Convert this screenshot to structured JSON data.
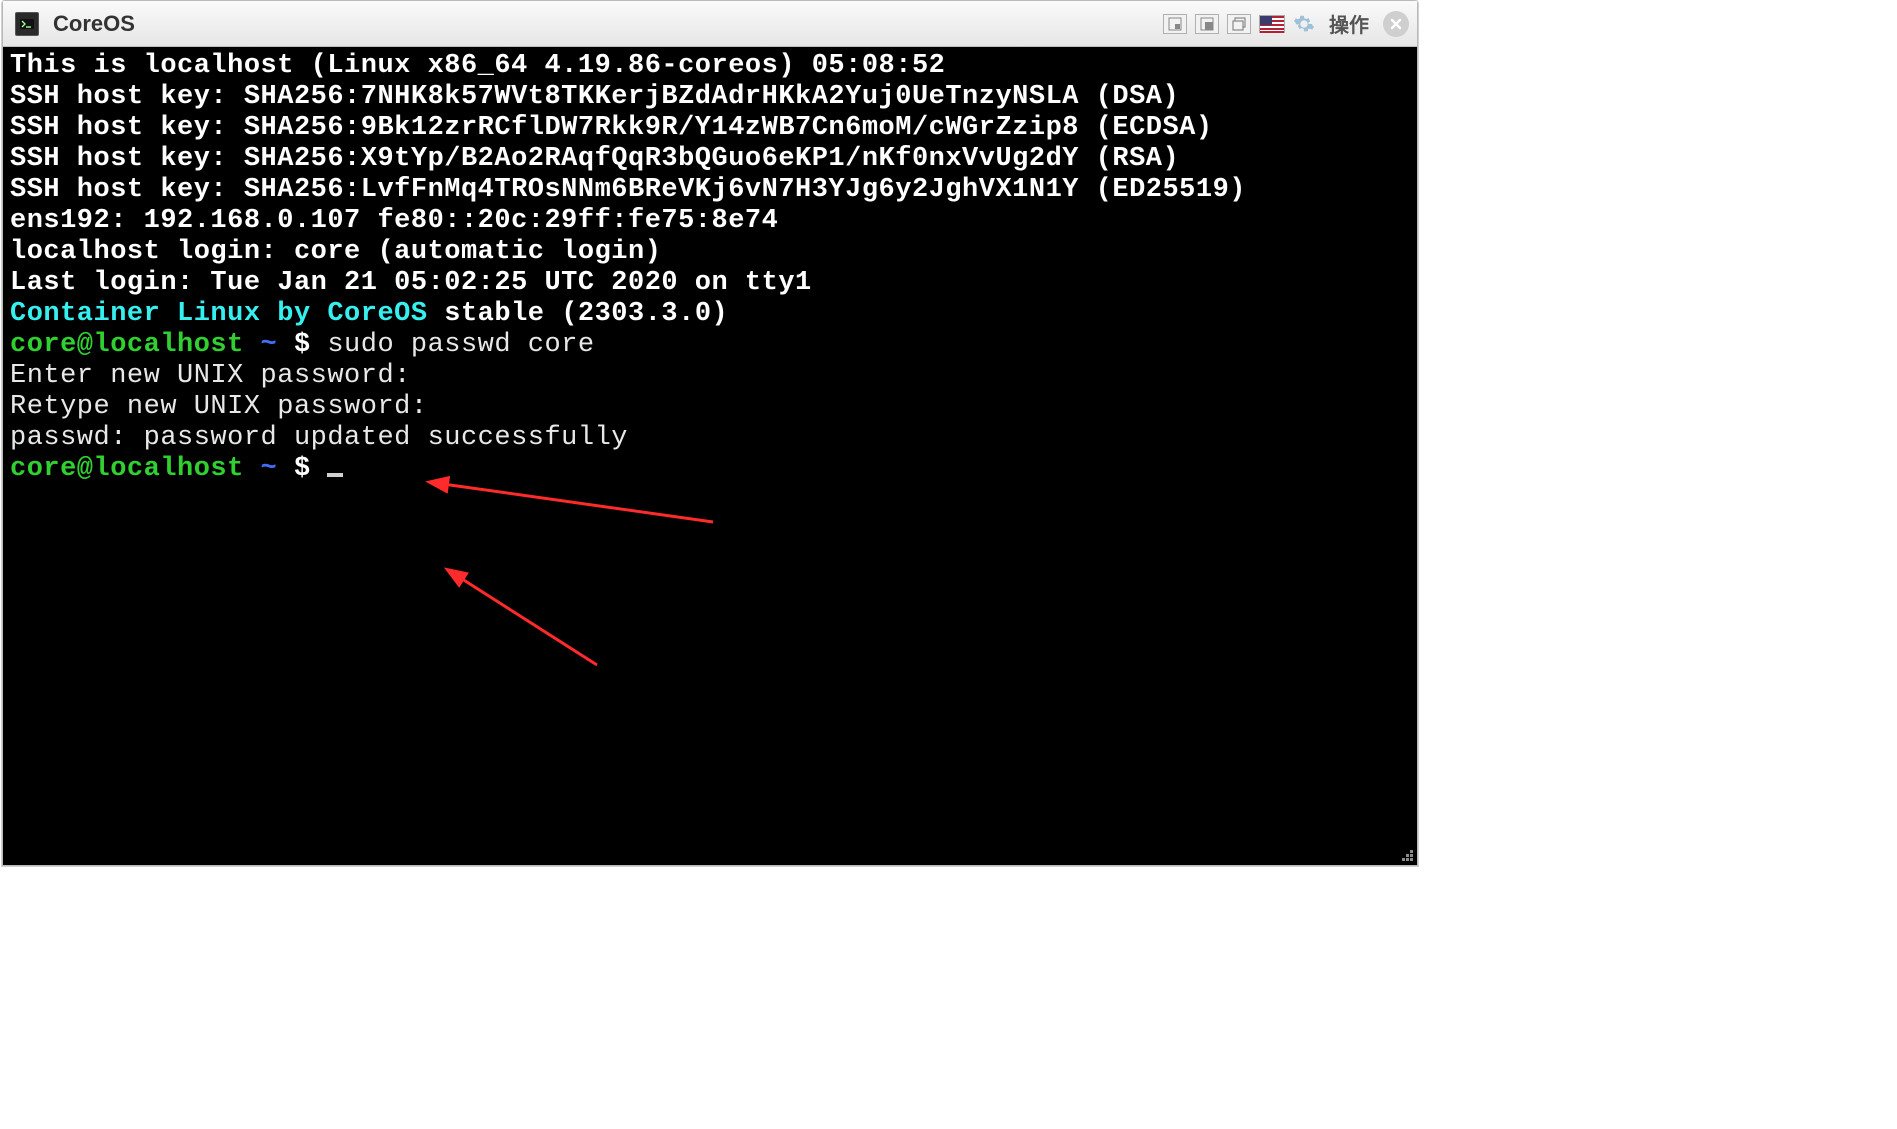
{
  "window": {
    "title": "CoreOS",
    "action_label": "操作"
  },
  "icons": {
    "titlebar_btn1": "pip-small-icon",
    "titlebar_btn2": "pip-large-icon",
    "titlebar_btn3": "restore-icon",
    "flag": "us-flag-icon",
    "gear": "gear-icon",
    "close": "close-icon"
  },
  "terminal": {
    "blank_top": "",
    "line1": "This is localhost (Linux x86_64 4.19.86-coreos) 05:08:52",
    "line2": "SSH host key: SHA256:7NHK8k57WVt8TKKerjBZdAdrHKkA2Yuj0UeTnzyNSLA (DSA)",
    "line3": "SSH host key: SHA256:9Bk12zrRCflDW7Rkk9R/Y14zWB7Cn6moM/cWGrZzip8 (ECDSA)",
    "line4": "SSH host key: SHA256:X9tYp/B2Ao2RAqfQqR3bQGuo6eKP1/nKf0nxVvUg2dY (RSA)",
    "line5": "SSH host key: SHA256:LvfFnMq4TROsNNm6BReVKj6vN7H3YJg6y2JghVX1N1Y (ED25519)",
    "line6": "ens192: 192.168.0.107 fe80::20c:29ff:fe75:8e74",
    "blank_mid1": "",
    "login_line": "localhost login: core (automatic login)",
    "blank_mid2": "",
    "lastlogin": "Last login: Tue Jan 21 05:02:25 UTC 2020 on tty1",
    "distro_cyan": "Container Linux by CoreOS",
    "distro_rest": " stable (2303.3.0)",
    "prompt1_userhost": "core@localhost",
    "prompt1_tilde": " ~ ",
    "prompt1_dollar": "$ ",
    "prompt1_cmd": "sudo passwd core",
    "pw_enter": "Enter new UNIX password:",
    "pw_retype": "Retype new UNIX password:",
    "pw_success": "passwd: password updated successfully",
    "prompt2_userhost": "core@localhost",
    "prompt2_tilde": " ~ ",
    "prompt2_dollar": "$ "
  }
}
